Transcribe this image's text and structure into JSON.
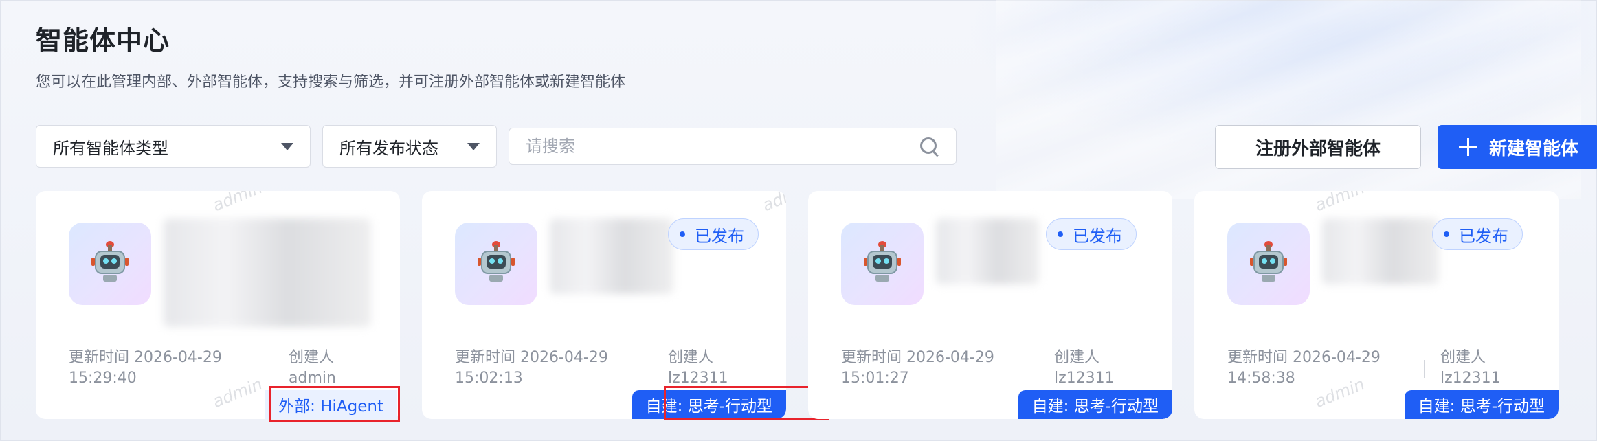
{
  "header": {
    "title": "智能体中心",
    "subtitle": "您可以在此管理内部、外部智能体，支持搜索与筛选，并可注册外部智能体或新建智能体"
  },
  "filters": {
    "type_select": "所有智能体类型",
    "status_select": "所有发布状态",
    "search_placeholder": "请搜索"
  },
  "actions": {
    "register_label": "注册外部智能体",
    "new_label": "新建智能体"
  },
  "watermark": "admin",
  "cards": [
    {
      "status": "",
      "update_label": "更新时间 2026-04-29",
      "update_time": "15:29:40",
      "creator_label": "创建人",
      "creator": "admin",
      "tag": "外部: HiAgent"
    },
    {
      "status": "已发布",
      "update_label": "更新时间 2026-04-29",
      "update_time": "15:02:13",
      "creator_label": "创建人",
      "creator": "lz12311",
      "tag": "自建: 思考-行动型"
    },
    {
      "status": "已发布",
      "update_label": "更新时间 2026-04-29",
      "update_time": "15:01:27",
      "creator_label": "创建人",
      "creator": "lz12311",
      "tag": "自建: 思考-行动型"
    },
    {
      "status": "已发布",
      "update_label": "更新时间 2026-04-29",
      "update_time": "14:58:38",
      "creator_label": "创建人",
      "creator": "lz12311",
      "tag": "自建: 思考-行动型"
    }
  ],
  "colors": {
    "primary": "#1f5ef5",
    "highlight": "#e8232c"
  }
}
